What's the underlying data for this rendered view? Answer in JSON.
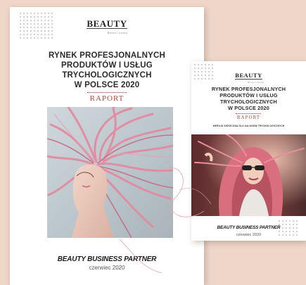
{
  "main_report": {
    "brand": "BEAUTY",
    "brand_tagline": "Biznes i rozwój",
    "title_lines": [
      "RYNEK PROFESJONALNYCH",
      "PRODUKTÓW I USŁUG",
      "TRYCHOLOGICZNYCH",
      "W POLSCE 2020"
    ],
    "label": "RAPORT",
    "publisher": "BEAUTY BUSINESS PARTNER",
    "date": "czerwiec 2020"
  },
  "side_report": {
    "brand": "BEAUTY",
    "brand_tagline": "Biznes i rozwój",
    "title_lines": [
      "RYNEK PROFESJONALNYCH",
      "PRODUKTÓW I USŁUG",
      "TRYCHOLOGICZNYCH",
      "W POLSCE 2020"
    ],
    "label": "RAPORT",
    "subtitle": "WERSJA SKRÓCONA DLA SALONÓW TRYCHOLOGICZNYCH",
    "publisher": "BEAUTY BUSINESS PARTNER",
    "date": "czerwiec 2020"
  },
  "colors": {
    "background": "#eed6c8",
    "accent": "#b2473e",
    "hair_pink": "#e38aa0",
    "swirl": "#e0a3a9"
  }
}
